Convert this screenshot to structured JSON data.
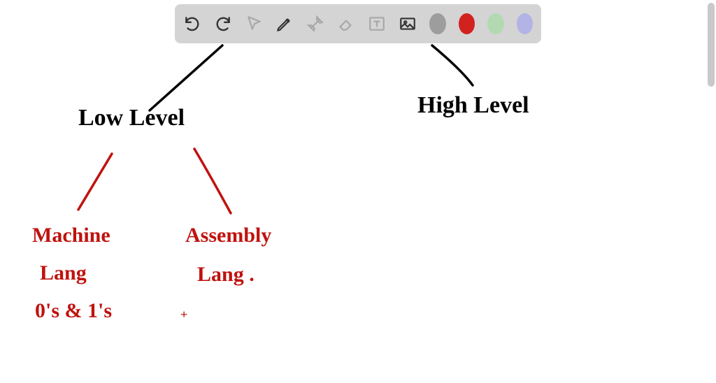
{
  "toolbar": {
    "tools": [
      {
        "name": "undo-icon",
        "interactable": true,
        "disabled": false
      },
      {
        "name": "redo-icon",
        "interactable": true,
        "disabled": false
      },
      {
        "name": "select-icon",
        "interactable": true,
        "disabled": true
      },
      {
        "name": "pen-icon",
        "interactable": true,
        "disabled": false
      },
      {
        "name": "tools-icon",
        "interactable": true,
        "disabled": true
      },
      {
        "name": "eraser-icon",
        "interactable": true,
        "disabled": true
      },
      {
        "name": "text-icon",
        "interactable": true,
        "disabled": true
      },
      {
        "name": "image-icon",
        "interactable": true,
        "disabled": false
      }
    ],
    "colors": [
      {
        "name": "color-gray",
        "hex": "#9d9d9d"
      },
      {
        "name": "color-red",
        "hex": "#d2221f"
      },
      {
        "name": "color-green",
        "hex": "#b3d9b3"
      },
      {
        "name": "color-purple",
        "hex": "#b3b3e6"
      }
    ]
  },
  "diagram": {
    "nodes": {
      "low_level": "Low Level",
      "high_level": "High Level",
      "machine_lang_l1": "Machine",
      "machine_lang_l2": "Lang",
      "machine_lang_l3": "0's & 1's",
      "assembly_lang_l1": "Assembly",
      "assembly_lang_l2": "Lang ."
    },
    "edges": [
      {
        "from": "root",
        "to": "low_level",
        "color": "#000"
      },
      {
        "from": "root",
        "to": "high_level",
        "color": "#000"
      },
      {
        "from": "low_level",
        "to": "machine_lang",
        "color": "#c0120e"
      },
      {
        "from": "low_level",
        "to": "assembly_lang",
        "color": "#c0120e"
      }
    ]
  }
}
